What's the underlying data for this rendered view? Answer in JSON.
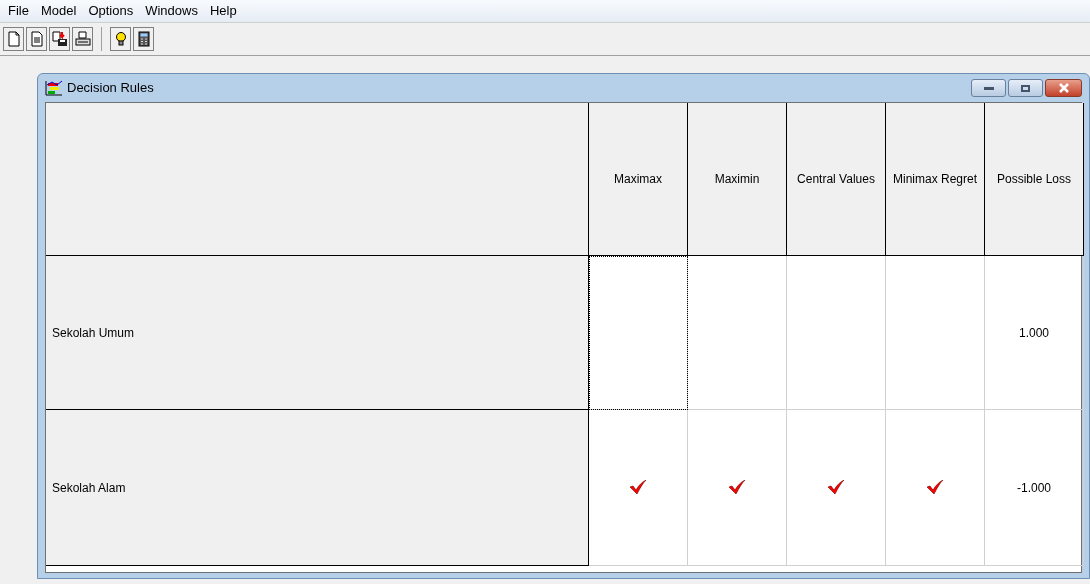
{
  "menu": [
    "File",
    "Model",
    "Options",
    "Windows",
    "Help"
  ],
  "window": {
    "title": "Decision Rules"
  },
  "table": {
    "columns": [
      "Maximax",
      "Maximin",
      "Central Values",
      "Minimax Regret",
      "Possible Loss"
    ],
    "rows": [
      {
        "label": "Sekolah Umum",
        "cells": [
          {
            "kind": "empty",
            "focused": true
          },
          {
            "kind": "empty",
            "focused": false
          },
          {
            "kind": "empty",
            "focused": false
          },
          {
            "kind": "empty",
            "focused": false
          },
          {
            "kind": "text",
            "text": "1.000",
            "focused": false
          }
        ]
      },
      {
        "label": "Sekolah Alam",
        "cells": [
          {
            "kind": "check",
            "focused": false
          },
          {
            "kind": "check",
            "focused": false
          },
          {
            "kind": "check",
            "focused": false
          },
          {
            "kind": "check",
            "focused": false
          },
          {
            "kind": "text",
            "text": "-1.000",
            "focused": false
          }
        ]
      }
    ]
  }
}
